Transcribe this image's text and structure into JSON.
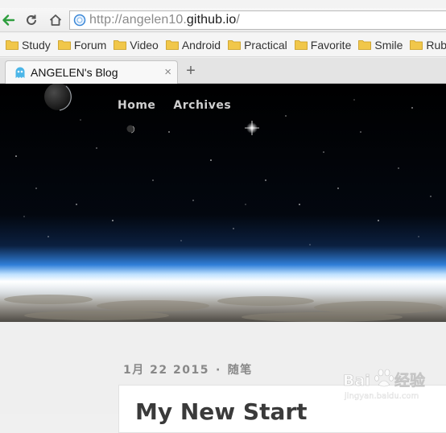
{
  "browser": {
    "url_prefix": "http://angelen10.",
    "url_host": "github.io",
    "url_suffix": "/",
    "bookmarks": [
      "Study",
      "Forum",
      "Video",
      "Android",
      "Practical",
      "Favorite",
      "Smile",
      "Rubbish"
    ],
    "tab_title": "ANGELEN's Blog",
    "tab_close": "×",
    "new_tab": "+"
  },
  "site": {
    "nav": [
      "Home",
      "Archives"
    ]
  },
  "post": {
    "date": "1月 22 2015",
    "separator": "·",
    "category": "随笔",
    "title": "My New Start"
  },
  "watermark": {
    "brand": "Baidu经验",
    "domain": "jingyan.baidu.com"
  },
  "colors": {
    "back_arrow": "#2e9e3e",
    "folder": "#f1c74a",
    "banner_horizon": "#4fa8ff"
  },
  "icons": [
    "back-arrow-icon",
    "reload-icon",
    "home-icon",
    "globe-icon",
    "folder-icon",
    "ghost-favicon-icon",
    "close-icon",
    "plus-icon"
  ]
}
